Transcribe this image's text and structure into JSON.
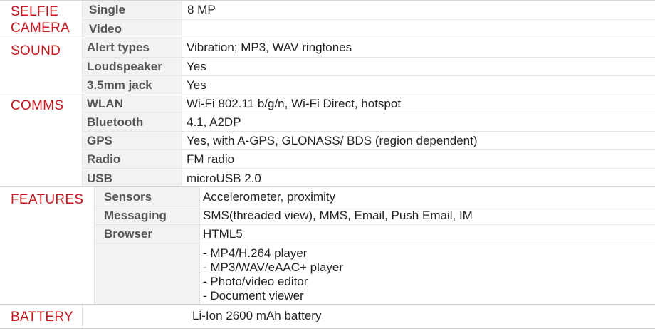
{
  "sections": {
    "selfie_camera": {
      "title_line1": "SELFIE",
      "title_line2": "CAMERA",
      "rows": [
        {
          "label": "Single",
          "value": "8 MP"
        },
        {
          "label": "Video",
          "value": ""
        }
      ]
    },
    "sound": {
      "title": "SOUND",
      "rows": [
        {
          "label": "Alert types",
          "value": "Vibration; MP3, WAV ringtones"
        },
        {
          "label": "Loudspeaker",
          "value": "Yes"
        },
        {
          "label": "3.5mm jack",
          "value": "Yes"
        }
      ]
    },
    "comms": {
      "title": "COMMS",
      "rows": [
        {
          "label": "WLAN",
          "value": "Wi-Fi 802.11 b/g/n, Wi-Fi Direct, hotspot"
        },
        {
          "label": "Bluetooth",
          "value": "4.1, A2DP"
        },
        {
          "label": "GPS",
          "value": "Yes, with A-GPS, GLONASS/ BDS (region dependent)"
        },
        {
          "label": "Radio",
          "value": "FM radio"
        },
        {
          "label": "USB",
          "value": "microUSB 2.0"
        }
      ]
    },
    "features": {
      "title": "FEATURES",
      "rows": [
        {
          "label": "Sensors",
          "value": "Accelerometer, proximity"
        },
        {
          "label": "Messaging",
          "value": "SMS(threaded view), MMS, Email, Push Email, IM"
        },
        {
          "label": "Browser",
          "value": "HTML5"
        }
      ],
      "extra_lines": [
        "- MP4/H.264 player",
        "- MP3/WAV/eAAC+ player",
        "- Photo/video editor",
        "- Document viewer"
      ]
    },
    "battery": {
      "title": "BATTERY",
      "value": "Li-Ion 2600 mAh battery"
    }
  }
}
